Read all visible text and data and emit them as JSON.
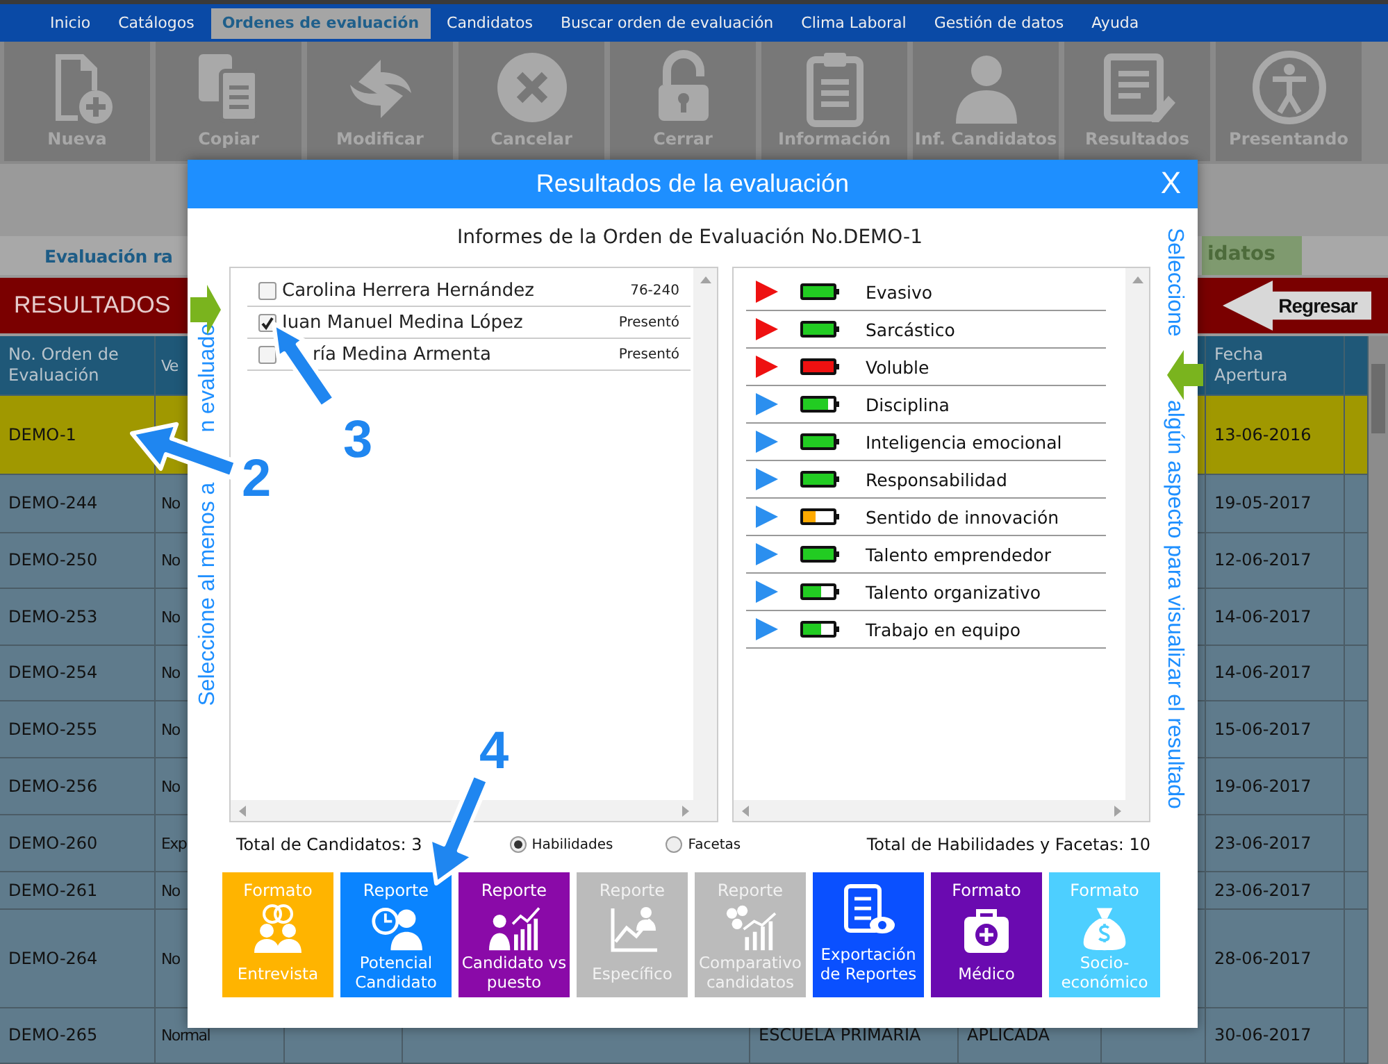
{
  "menu": [
    {
      "label": "Inicio",
      "selected": false
    },
    {
      "label": "Catálogos",
      "selected": false
    },
    {
      "label": "Ordenes de evaluación",
      "selected": true
    },
    {
      "label": "Candidatos",
      "selected": false
    },
    {
      "label": "Buscar orden de evaluación",
      "selected": false
    },
    {
      "label": "Clima Laboral",
      "selected": false
    },
    {
      "label": "Gestión de datos",
      "selected": false
    },
    {
      "label": "Ayuda",
      "selected": false
    }
  ],
  "toolbar": [
    {
      "label": "Nueva",
      "disabled": true
    },
    {
      "label": "Copiar",
      "disabled": true
    },
    {
      "label": "Modificar",
      "disabled": true
    },
    {
      "label": "Cancelar",
      "disabled": true
    },
    {
      "label": "Cerrar",
      "disabled": true
    },
    {
      "label": "Información",
      "disabled": true
    },
    {
      "label": "Inf. Candidatos",
      "disabled": true
    },
    {
      "label": "Resultados",
      "disabled": true
    },
    {
      "label": "Presentando",
      "disabled": true
    }
  ],
  "banner": {
    "title": "Evaluación ra",
    "tag": "idatos"
  },
  "section": {
    "title": "RESULTADOS",
    "back_button": "Regresar"
  },
  "table": {
    "header": {
      "no_orden": "No. Orden de Evaluación",
      "column_2": "Ve",
      "fecha_apertura": "Fecha Apertura"
    },
    "rows": [
      {
        "no_orden": "DEMO-1",
        "fecha_apertura": "13-06-2016",
        "selected": true
      },
      {
        "no_orden": "DEMO-244",
        "column_2": "No",
        "fecha_apertura": "19-05-2017",
        "selected": false
      },
      {
        "no_orden": "DEMO-250",
        "column_2": "No",
        "fecha_apertura": "12-06-2017",
        "selected": false
      },
      {
        "no_orden": "DEMO-253",
        "column_2": "No",
        "fecha_apertura": "14-06-2017",
        "selected": false
      },
      {
        "no_orden": "DEMO-254",
        "column_2": "No",
        "fecha_apertura": "14-06-2017",
        "selected": false
      },
      {
        "no_orden": "DEMO-255",
        "column_2": "No",
        "fecha_apertura": "15-06-2017",
        "selected": false
      },
      {
        "no_orden": "DEMO-256",
        "column_2": "No",
        "fecha_apertura": "19-06-2017",
        "selected": false
      },
      {
        "no_orden": "DEMO-260",
        "column_2": "Exp",
        "fecha_apertura": "23-06-2017",
        "selected": false
      },
      {
        "no_orden": "DEMO-261",
        "column_2": "No",
        "fecha_apertura": "23-06-2017",
        "selected": false
      },
      {
        "no_orden": "DEMO-264",
        "column_2": "No",
        "fecha_apertura": "28-06-2017",
        "selected": false
      },
      {
        "no_orden": "DEMO-265",
        "column_2": "Normal",
        "column_5": "ESCUELA PRIMARIA",
        "column_6": "APLICADA",
        "fecha_apertura": "30-06-2017",
        "selected": false
      }
    ]
  },
  "dialog": {
    "title": "Resultados de la evaluación",
    "close": "X",
    "subtitle": "Informes de la Orden de Evaluación No.DEMO-1",
    "left_hint": [
      "Seleccione al menos a",
      "n evaluado"
    ],
    "right_hint": [
      "Seleccione",
      "algún aspecto para visualizar el resultado"
    ],
    "candidates": [
      {
        "name": "Carolina Herrera Hernández",
        "status": "76-240",
        "checked": false
      },
      {
        "name": "Juan Manuel Medina López",
        "status": "Presentó",
        "checked": true
      },
      {
        "name": "ría Medina Armenta",
        "status": "Presentó",
        "checked": false
      }
    ],
    "skills": [
      {
        "label": "Evasivo",
        "color": "#ee1111",
        "battery": {
          "level": 1,
          "color": "#22cc22"
        }
      },
      {
        "label": "Sarcástico",
        "color": "#ee1111",
        "battery": {
          "level": 1,
          "color": "#22cc22"
        }
      },
      {
        "label": "Voluble",
        "color": "#ee1111",
        "battery": {
          "level": 1,
          "color": "#ee1111"
        }
      },
      {
        "label": "Disciplina",
        "color": "#2b8fef",
        "battery": {
          "level": 0.8,
          "color": "#22cc22"
        }
      },
      {
        "label": "Inteligencia emocional",
        "color": "#2b8fef",
        "battery": {
          "level": 1,
          "color": "#22cc22"
        }
      },
      {
        "label": "Responsabilidad",
        "color": "#2b8fef",
        "battery": {
          "level": 1,
          "color": "#22cc22"
        }
      },
      {
        "label": "Sentido de innovación",
        "color": "#2b8fef",
        "battery": {
          "level": 0.4,
          "color": "#ffaa00"
        }
      },
      {
        "label": "Talento emprendedor",
        "color": "#2b8fef",
        "battery": {
          "level": 1,
          "color": "#22cc22"
        }
      },
      {
        "label": "Talento organizativo",
        "color": "#2b8fef",
        "battery": {
          "level": 0.6,
          "color": "#22cc22"
        }
      },
      {
        "label": "Trabajo en equipo",
        "color": "#2b8fef",
        "battery": {
          "level": 0.6,
          "color": "#22cc22"
        }
      }
    ],
    "total_candidates": "Total de Candidatos: 3",
    "filters": [
      {
        "label": "Habilidades",
        "selected": true
      },
      {
        "label": "Facetas",
        "selected": false
      }
    ],
    "total_skills": "Total de Habilidades y Facetas: 10",
    "reports": [
      {
        "top": "Formato",
        "bottom": "Entrevista",
        "color": "#ffb400",
        "disabled": false
      },
      {
        "top": "Reporte",
        "bottom": "Potencial Candidato",
        "color": "#0a84ff",
        "disabled": false
      },
      {
        "top": "Reporte",
        "bottom": "Candidato vs puesto",
        "color": "#8a0aa8",
        "disabled": false
      },
      {
        "top": "Reporte",
        "bottom": "Específico",
        "color": "#bbbbbb",
        "disabled": true
      },
      {
        "top": "Reporte",
        "bottom": "Comparativo candidatos",
        "color": "#bbbbbb",
        "disabled": true
      },
      {
        "bottom": "Exportación de Reportes",
        "color": "#0a50ff",
        "disabled": false
      },
      {
        "top": "Formato",
        "bottom": "Médico",
        "color": "#6a0ab0",
        "disabled": false
      },
      {
        "top": "Formato",
        "bottom": "Socio-económico",
        "color": "#4dcfff",
        "disabled": false
      }
    ]
  },
  "callouts": [
    {
      "label": "2"
    },
    {
      "label": "3"
    },
    {
      "label": "4"
    }
  ]
}
